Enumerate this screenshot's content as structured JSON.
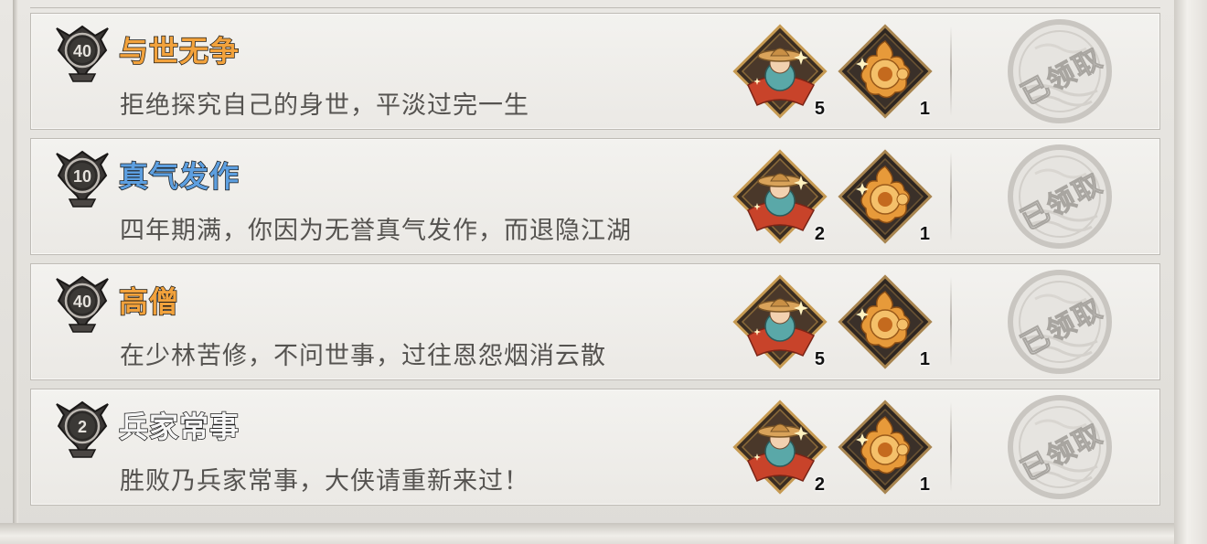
{
  "colors": {
    "title_orange": "#f2a23c",
    "title_blue": "#5d9fe0",
    "title_white": "#f6f6f6",
    "desc_text": "#555350",
    "row_bg": "#f0efec"
  },
  "stamp_label": "已领取",
  "endings": [
    {
      "medal_level": "40",
      "title": "与世无争",
      "title_color": "orange",
      "description": "拒绝探究自己的身世，平淡过完一生",
      "rewards": [
        {
          "icon": "monk-figure-icon",
          "count": "5"
        },
        {
          "icon": "golden-flame-orb-icon",
          "count": "1"
        }
      ],
      "claimed": true
    },
    {
      "medal_level": "10",
      "title": "真气发作",
      "title_color": "blue",
      "description": "四年期满，你因为无誉真气发作，而退隐江湖",
      "rewards": [
        {
          "icon": "monk-figure-icon",
          "count": "2"
        },
        {
          "icon": "golden-flame-orb-icon",
          "count": "1"
        }
      ],
      "claimed": true
    },
    {
      "medal_level": "40",
      "title": "高僧",
      "title_color": "orange",
      "description": "在少林苦修，不问世事，过往恩怨烟消云散",
      "rewards": [
        {
          "icon": "monk-figure-icon",
          "count": "5"
        },
        {
          "icon": "golden-flame-orb-icon",
          "count": "1"
        }
      ],
      "claimed": true
    },
    {
      "medal_level": "2",
      "title": "兵家常事",
      "title_color": "white",
      "description": "胜败乃兵家常事，大侠请重新来过！",
      "rewards": [
        {
          "icon": "monk-figure-icon",
          "count": "2"
        },
        {
          "icon": "golden-flame-orb-icon",
          "count": "1"
        }
      ],
      "claimed": true
    }
  ]
}
